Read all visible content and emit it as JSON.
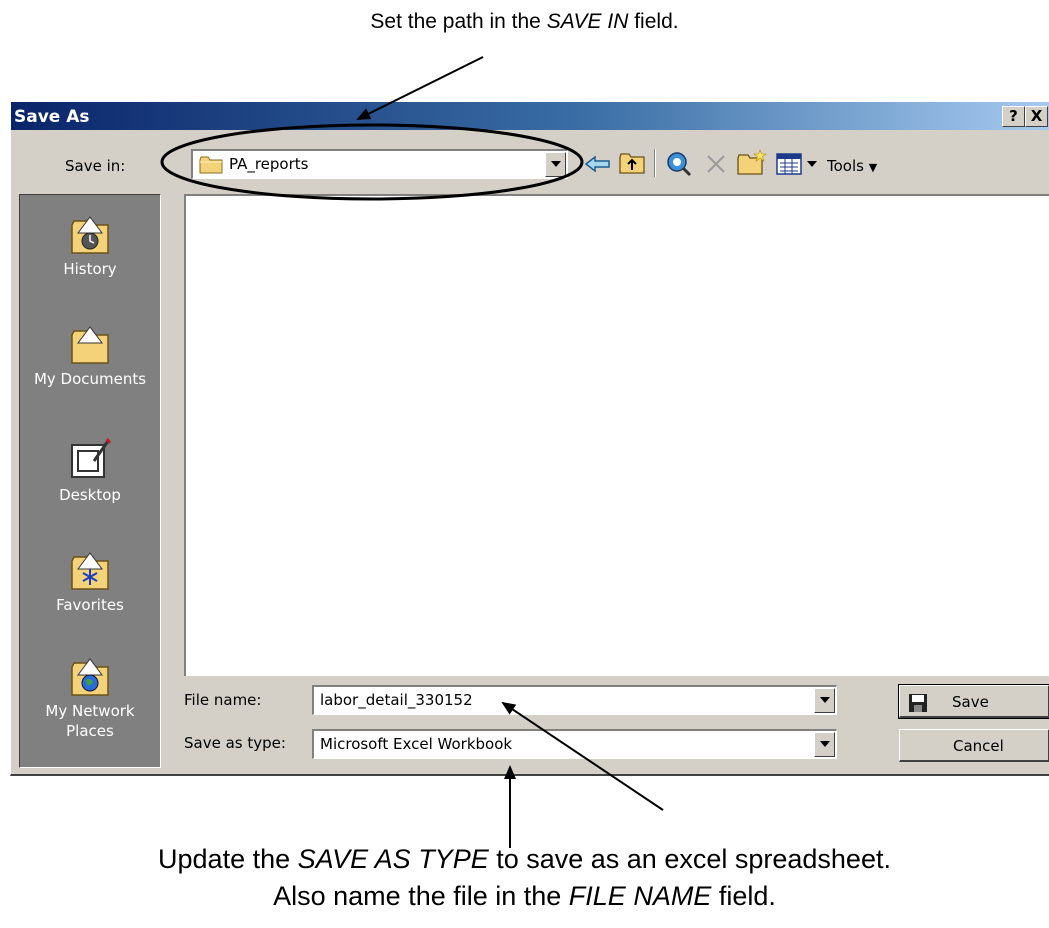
{
  "annotations": {
    "top": {
      "prefix": "Set the path in the ",
      "emph": "SAVE IN",
      "suffix": " field."
    },
    "bottom_line1": {
      "prefix": "Update the ",
      "emph": "SAVE AS TYPE",
      "suffix": " to save as an excel spreadsheet."
    },
    "bottom_line2": {
      "prefix": "Also name the file in the ",
      "emph": "FILE NAME",
      "suffix": " field."
    }
  },
  "dialog": {
    "title": "Save As",
    "help_button": "?",
    "close_button": "X",
    "save_in_label": "Save in:",
    "save_in_value": "PA_reports",
    "tools_label": "Tools",
    "places": [
      "History",
      "My Documents",
      "Desktop",
      "Favorites",
      "My Network Places"
    ],
    "file_name_label": "File name:",
    "file_name_value": "labor_detail_330152",
    "save_as_type_label": "Save as type:",
    "save_as_type_value": "Microsoft Excel Workbook",
    "save_button": "Save",
    "cancel_button": "Cancel"
  },
  "colors": {
    "title_gradient_start": "#0a246a",
    "title_gradient_end": "#a6caf0",
    "dialog_face": "#d4d0c8",
    "places_bar": "#808080"
  }
}
